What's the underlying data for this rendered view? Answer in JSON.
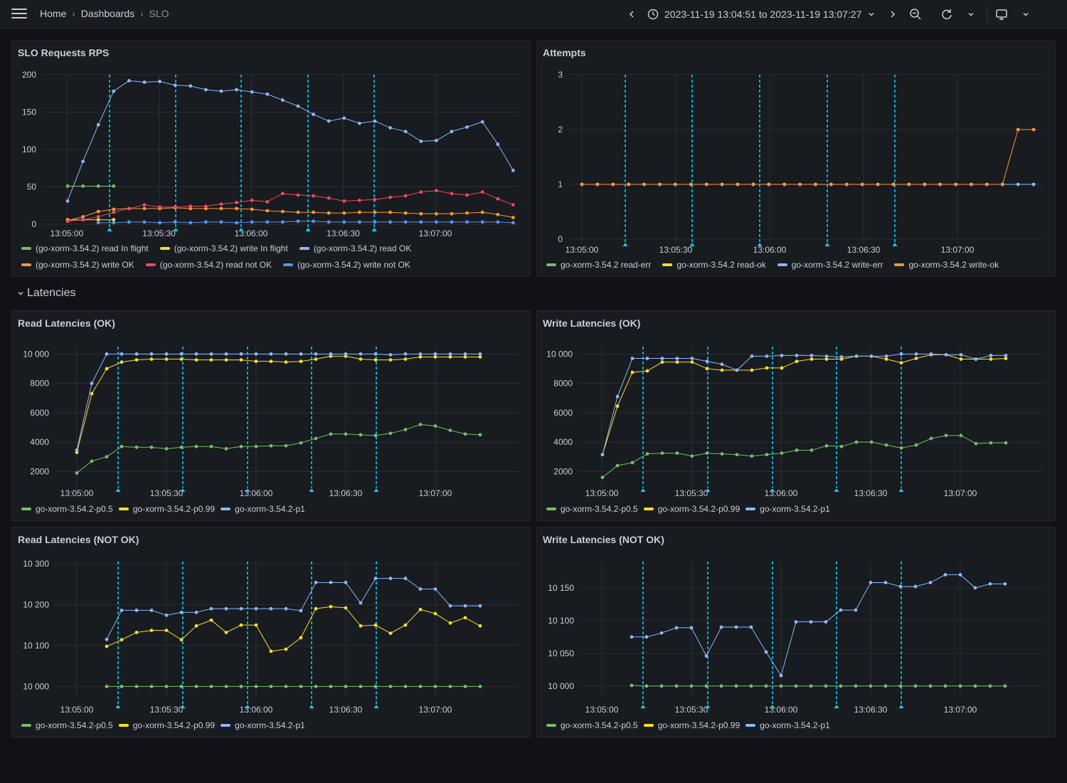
{
  "nav": {
    "breadcrumb": [
      "Home",
      "Dashboards",
      "SLO"
    ],
    "time_range": "2023-11-19 13:04:51 to 2023-11-19 13:07:27"
  },
  "row": {
    "title": "Latencies"
  },
  "colors": {
    "green": "#73bf69",
    "yellow": "#fade2a",
    "blue": "#8ab8ff",
    "orange": "#ff9830",
    "red": "#f2495c",
    "darkblue": "#5794f2",
    "annotation": "#00d3ff"
  },
  "panels": {
    "rps": {
      "title": "SLO Requests RPS"
    },
    "attempts": {
      "title": "Attempts"
    },
    "read_ok": {
      "title": "Read Latencies (OK)"
    },
    "write_ok": {
      "title": "Write Latencies (OK)"
    },
    "read_not_ok": {
      "title": "Read Latencies (NOT OK)"
    },
    "write_not_ok": {
      "title": "Write Latencies (NOT OK)"
    }
  },
  "chart_data": [
    {
      "id": "rps",
      "type": "line",
      "ylim": [
        0,
        200
      ],
      "yticks": [
        0,
        50,
        100,
        150,
        200
      ],
      "xticks": [
        "13:05:00",
        "13:05:30",
        "13:06:00",
        "13:06:30",
        "13:07:00"
      ],
      "annotations": [
        0,
        1,
        2,
        3,
        4
      ],
      "series": [
        {
          "name": "(go-xorm-3.54.2) read In flight",
          "color": "green",
          "x0": 0,
          "values": [
            51,
            51,
            51,
            51
          ]
        },
        {
          "name": "(go-xorm-3.54.2) write In flight",
          "color": "yellow",
          "x0": 0,
          "values": [
            6,
            6,
            6,
            6
          ]
        },
        {
          "name": "(go-xorm-3.54.2) read OK",
          "color": "blue",
          "x0": 0,
          "values": [
            31,
            84,
            133,
            178,
            192,
            190,
            191,
            186,
            185,
            180,
            178,
            180,
            177,
            174,
            166,
            158,
            147,
            138,
            142,
            135,
            138,
            129,
            124,
            111,
            112,
            124,
            130,
            137,
            107,
            72
          ]
        },
        {
          "name": "(go-xorm-3.54.2) write OK",
          "color": "orange",
          "x0": 0,
          "values": [
            5,
            10,
            17,
            20,
            21,
            21,
            21,
            22,
            21,
            21,
            21,
            21,
            20,
            18,
            17,
            16,
            16,
            15,
            15,
            16,
            16,
            16,
            15,
            14,
            14,
            14,
            15,
            16,
            13,
            9
          ]
        },
        {
          "name": "(go-xorm-3.54.2) read not OK",
          "color": "red",
          "x0": 0,
          "values": [
            4,
            6,
            10,
            16,
            21,
            26,
            23,
            23,
            24,
            24,
            27,
            29,
            32,
            30,
            41,
            39,
            38,
            35,
            31,
            32,
            33,
            36,
            38,
            43,
            45,
            41,
            39,
            43,
            34,
            26
          ]
        },
        {
          "name": "(go-xorm-3.54.2) write not OK",
          "color": "darkblue",
          "x0": 2,
          "values": [
            2,
            2,
            3,
            3,
            2,
            3,
            2,
            3,
            3,
            2,
            3,
            3,
            3,
            4,
            4,
            3,
            3,
            3,
            3,
            3,
            3,
            3,
            3,
            3,
            3,
            3,
            3,
            2
          ]
        }
      ]
    },
    {
      "id": "attempts",
      "type": "line",
      "ylim": [
        0,
        3
      ],
      "yticks": [
        0,
        1,
        2,
        3
      ],
      "xticks": [
        "13:05:00",
        "13:05:30",
        "13:06:00",
        "13:06:30",
        "13:07:00"
      ],
      "annotations": [
        0,
        1,
        2,
        3,
        4
      ],
      "series": [
        {
          "name": "go-xorm-3.54.2 read-err",
          "color": "green",
          "x0": 0,
          "values": []
        },
        {
          "name": "go-xorm-3.54.2 read-ok",
          "color": "yellow",
          "x0": 0,
          "values": []
        },
        {
          "name": "go-xorm-3.54.2 write-err",
          "color": "blue",
          "x0": 0,
          "values": [
            1,
            1,
            1,
            1,
            1,
            1,
            1,
            1,
            1,
            1,
            1,
            1,
            1,
            1,
            1,
            1,
            1,
            1,
            1,
            1,
            1,
            1,
            1,
            1,
            1,
            1,
            1,
            1,
            1,
            1
          ]
        },
        {
          "name": "go-xorm-3.54.2 write-ok",
          "color": "orange",
          "x0": 0,
          "values": [
            1,
            1,
            1,
            1,
            1,
            1,
            1,
            1,
            1,
            1,
            1,
            1,
            1,
            1,
            1,
            1,
            1,
            1,
            1,
            1,
            1,
            1,
            1,
            1,
            1,
            1,
            1,
            1,
            2,
            2
          ]
        }
      ]
    },
    {
      "id": "read_ok",
      "type": "line",
      "ylim": [
        1000,
        10500
      ],
      "yticks": [
        2000,
        4000,
        6000,
        8000,
        10000
      ],
      "xticks": [
        "13:05:00",
        "13:05:30",
        "13:06:00",
        "13:06:30",
        "13:07:00"
      ],
      "annotations": [
        0,
        1,
        2,
        3,
        4
      ],
      "series": [
        {
          "name": "go-xorm-3.54.2-p0.5",
          "color": "green",
          "x0": 0,
          "values": [
            1900,
            2700,
            3000,
            3700,
            3650,
            3650,
            3550,
            3650,
            3700,
            3700,
            3550,
            3700,
            3700,
            3750,
            3750,
            3950,
            4250,
            4550,
            4550,
            4500,
            4450,
            4600,
            4850,
            5200,
            5100,
            4800,
            4550,
            4500
          ]
        },
        {
          "name": "go-xorm-3.54.2-p0.99",
          "color": "yellow",
          "x0": 0,
          "values": [
            3300,
            7300,
            9000,
            9450,
            9600,
            9650,
            9650,
            9650,
            9600,
            9600,
            9600,
            9600,
            9500,
            9500,
            9450,
            9500,
            9650,
            9850,
            9850,
            9650,
            9600,
            9600,
            9650,
            9800,
            9800,
            9800,
            9800,
            9800
          ]
        },
        {
          "name": "go-xorm-3.54.2-p1",
          "color": "blue",
          "x0": 0,
          "values": [
            3450,
            8000,
            10000,
            10000,
            10000,
            10000,
            10000,
            10000,
            10000,
            10000,
            10000,
            10000,
            10000,
            10000,
            10000,
            10000,
            10000,
            10000,
            10000,
            10000,
            10000,
            9950,
            10000,
            10000,
            10000,
            10000,
            10000,
            10000
          ]
        }
      ]
    },
    {
      "id": "write_ok",
      "type": "line",
      "ylim": [
        1000,
        10500
      ],
      "yticks": [
        2000,
        4000,
        6000,
        8000,
        10000
      ],
      "xticks": [
        "13:05:00",
        "13:05:30",
        "13:06:00",
        "13:06:30",
        "13:07:00"
      ],
      "annotations": [
        0,
        1,
        2,
        3,
        4
      ],
      "series": [
        {
          "name": "go-xorm-3.54.2-p0.5",
          "color": "green",
          "x0": 0,
          "values": [
            1600,
            2400,
            2600,
            3200,
            3250,
            3250,
            3050,
            3250,
            3200,
            3150,
            3050,
            3150,
            3250,
            3450,
            3450,
            3750,
            3700,
            4000,
            4000,
            3800,
            3600,
            3800,
            4250,
            4450,
            4450,
            3900,
            3950,
            3950
          ]
        },
        {
          "name": "go-xorm-3.54.2-p0.99",
          "color": "yellow",
          "x0": 0,
          "values": [
            3150,
            6450,
            8750,
            8850,
            9450,
            9450,
            9450,
            9000,
            8900,
            8900,
            8900,
            9050,
            9050,
            9500,
            9650,
            9650,
            9650,
            9850,
            9850,
            9650,
            9400,
            9700,
            9950,
            9950,
            9650,
            9650,
            9650,
            9700
          ]
        },
        {
          "name": "go-xorm-3.54.2-p1",
          "color": "blue",
          "x0": 0,
          "values": [
            3150,
            7100,
            9700,
            9700,
            9700,
            9700,
            9700,
            9500,
            9300,
            8900,
            9850,
            9850,
            9900,
            9900,
            9900,
            9850,
            9800,
            9850,
            9850,
            9850,
            10000,
            10000,
            10000,
            9950,
            9950,
            9650,
            9900,
            9900
          ]
        }
      ]
    },
    {
      "id": "read_not_ok",
      "type": "line",
      "ylim": [
        9985,
        10305
      ],
      "yticks": [
        10000,
        10100,
        10200,
        10300
      ],
      "xticks": [
        "13:05:00",
        "13:05:30",
        "13:06:00",
        "13:06:30",
        "13:07:00"
      ],
      "annotations": [
        0,
        1,
        2,
        3,
        4
      ],
      "series": [
        {
          "name": "go-xorm-3.54.2-p0.5",
          "color": "green",
          "x0": 2,
          "values": [
            10000,
            10000,
            10000,
            10000,
            10000,
            10000,
            10000,
            10000,
            10000,
            10000,
            10000,
            10000,
            10000,
            10000,
            10000,
            10000,
            10000,
            10000,
            10000,
            10000,
            10000,
            10000,
            10000,
            10000,
            10000,
            10000
          ]
        },
        {
          "name": "go-xorm-3.54.2-p0.99",
          "color": "yellow",
          "x0": 2,
          "values": [
            10098,
            10114,
            10132,
            10137,
            10137,
            10114,
            10148,
            10162,
            10132,
            10150,
            10150,
            10086,
            10091,
            10119,
            10190,
            10195,
            10192,
            10148,
            10150,
            10130,
            10150,
            10188,
            10178,
            10155,
            10168,
            10148
          ]
        },
        {
          "name": "go-xorm-3.54.2-p1",
          "color": "blue",
          "x0": 2,
          "values": [
            10115,
            10186,
            10186,
            10186,
            10174,
            10181,
            10181,
            10190,
            10190,
            10190,
            10190,
            10190,
            10190,
            10185,
            10254,
            10254,
            10254,
            10204,
            10264,
            10264,
            10264,
            10238,
            10238,
            10197,
            10197,
            10197
          ]
        }
      ]
    },
    {
      "id": "write_not_ok",
      "type": "line",
      "ylim": [
        9990,
        10190
      ],
      "yticks": [
        10000,
        10050,
        10100,
        10150
      ],
      "xticks": [
        "13:05:00",
        "13:05:30",
        "13:06:00",
        "13:06:30",
        "13:07:00"
      ],
      "annotations": [
        0,
        1,
        2,
        3,
        4
      ],
      "series": [
        {
          "name": "go-xorm-3.54.2-p0.5",
          "color": "green",
          "x0": 2,
          "values": [
            10001,
            10000,
            10000,
            10000,
            10000,
            10000,
            10000,
            10000,
            10000,
            10000,
            10000,
            10000,
            10000,
            10000,
            10000,
            10000,
            10000,
            10000,
            10000,
            10000,
            10000,
            10000,
            10000,
            10000,
            10000,
            10000
          ]
        },
        {
          "name": "go-xorm-3.54.2-p0.99",
          "color": "yellow",
          "x0": 2,
          "values": []
        },
        {
          "name": "go-xorm-3.54.2-p1",
          "color": "blue",
          "x0": 2,
          "values": [
            10075,
            10075,
            10081,
            10089,
            10089,
            10046,
            10090,
            10090,
            10090,
            10052,
            10016,
            10098,
            10098,
            10098,
            10116,
            10116,
            10158,
            10158,
            10152,
            10152,
            10158,
            10170,
            10170,
            10150,
            10156,
            10156
          ]
        }
      ]
    }
  ]
}
